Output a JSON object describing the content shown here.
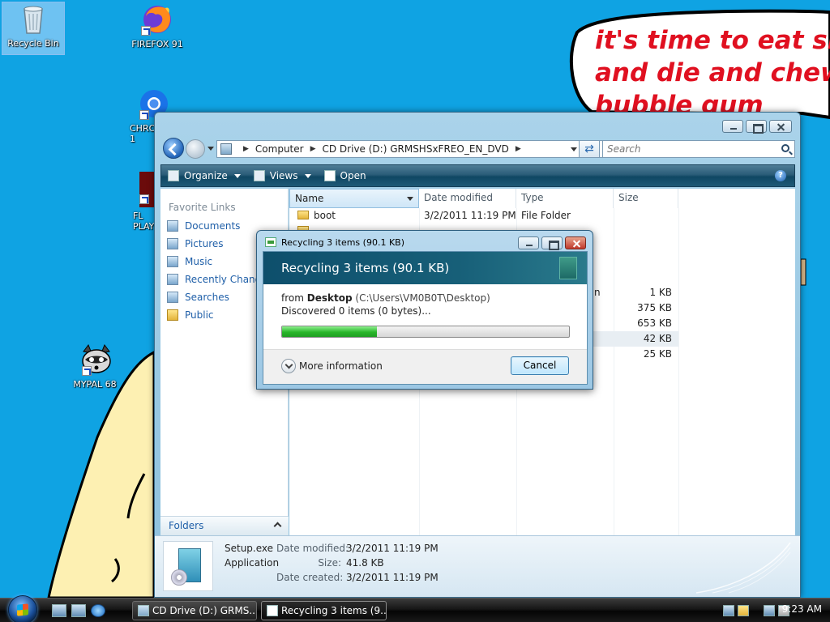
{
  "desktop": {
    "speech_lines": [
      "it's time to eat shit",
      "and die and chew",
      "bubble gum"
    ],
    "icons": [
      {
        "label": "Recycle Bin"
      },
      {
        "label": "FIREFOX 91"
      },
      {
        "label": "CHRO\n1"
      },
      {
        "label": "FL\nPLAY"
      },
      {
        "label": "MYPAL 68"
      }
    ]
  },
  "explorer": {
    "breadcrumb": [
      "Computer",
      "CD Drive (D:) GRMSHSxFREO_EN_DVD"
    ],
    "search_placeholder": "Search",
    "commands": {
      "organize": "Organize",
      "views": "Views",
      "open": "Open"
    },
    "nav": {
      "title": "Favorite Links",
      "items": [
        "Documents",
        "Pictures",
        "Music",
        "Recently Changed",
        "Searches",
        "Public"
      ],
      "folders_label": "Folders"
    },
    "columns": {
      "name": "Name",
      "date": "Date modified",
      "type": "Type",
      "size": "Size"
    },
    "rows": [
      {
        "name": "boot",
        "date": "3/2/2011 11:19 PM",
        "type": "File Folder",
        "size": ""
      },
      {
        "name": "",
        "date": "",
        "type": "n",
        "size": "1 KB"
      },
      {
        "name": "",
        "date": "",
        "type": "",
        "size": "375 KB"
      },
      {
        "name": "",
        "date": "",
        "type": "",
        "size": "653 KB"
      },
      {
        "name": "",
        "date": "",
        "type": "",
        "size": "42 KB"
      },
      {
        "name": "",
        "date": "",
        "type": "",
        "size": "25 KB"
      }
    ],
    "details": {
      "file_name": "Setup.exe",
      "file_type": "Application",
      "date_modified_label": "Date modified:",
      "date_modified": "3/2/2011 11:19 PM",
      "size_label": "Size:",
      "size": "41.8 KB",
      "date_created_label": "Date created:",
      "date_created": "3/2/2011 11:19 PM"
    }
  },
  "dialog": {
    "title": "Recycling 3 items (90.1 KB)",
    "heading": "Recycling 3 items (90.1 KB)",
    "from_label": "from",
    "from_name": "Desktop",
    "from_path": "(C:\\Users\\VM0B0T\\Desktop)",
    "discovered": "Discovered 0 items (0 bytes)...",
    "progress": 0.33,
    "more_info": "More information",
    "cancel": "Cancel"
  },
  "taskbar": {
    "tasks": [
      "CD Drive (D:) GRMS...",
      "Recycling 3 items (9..."
    ],
    "clock": "9:23 AM"
  },
  "colors": {
    "desktop_bg": "#0fa3e3",
    "speech_text": "#e01020",
    "progress_fill": "#29b62a"
  }
}
